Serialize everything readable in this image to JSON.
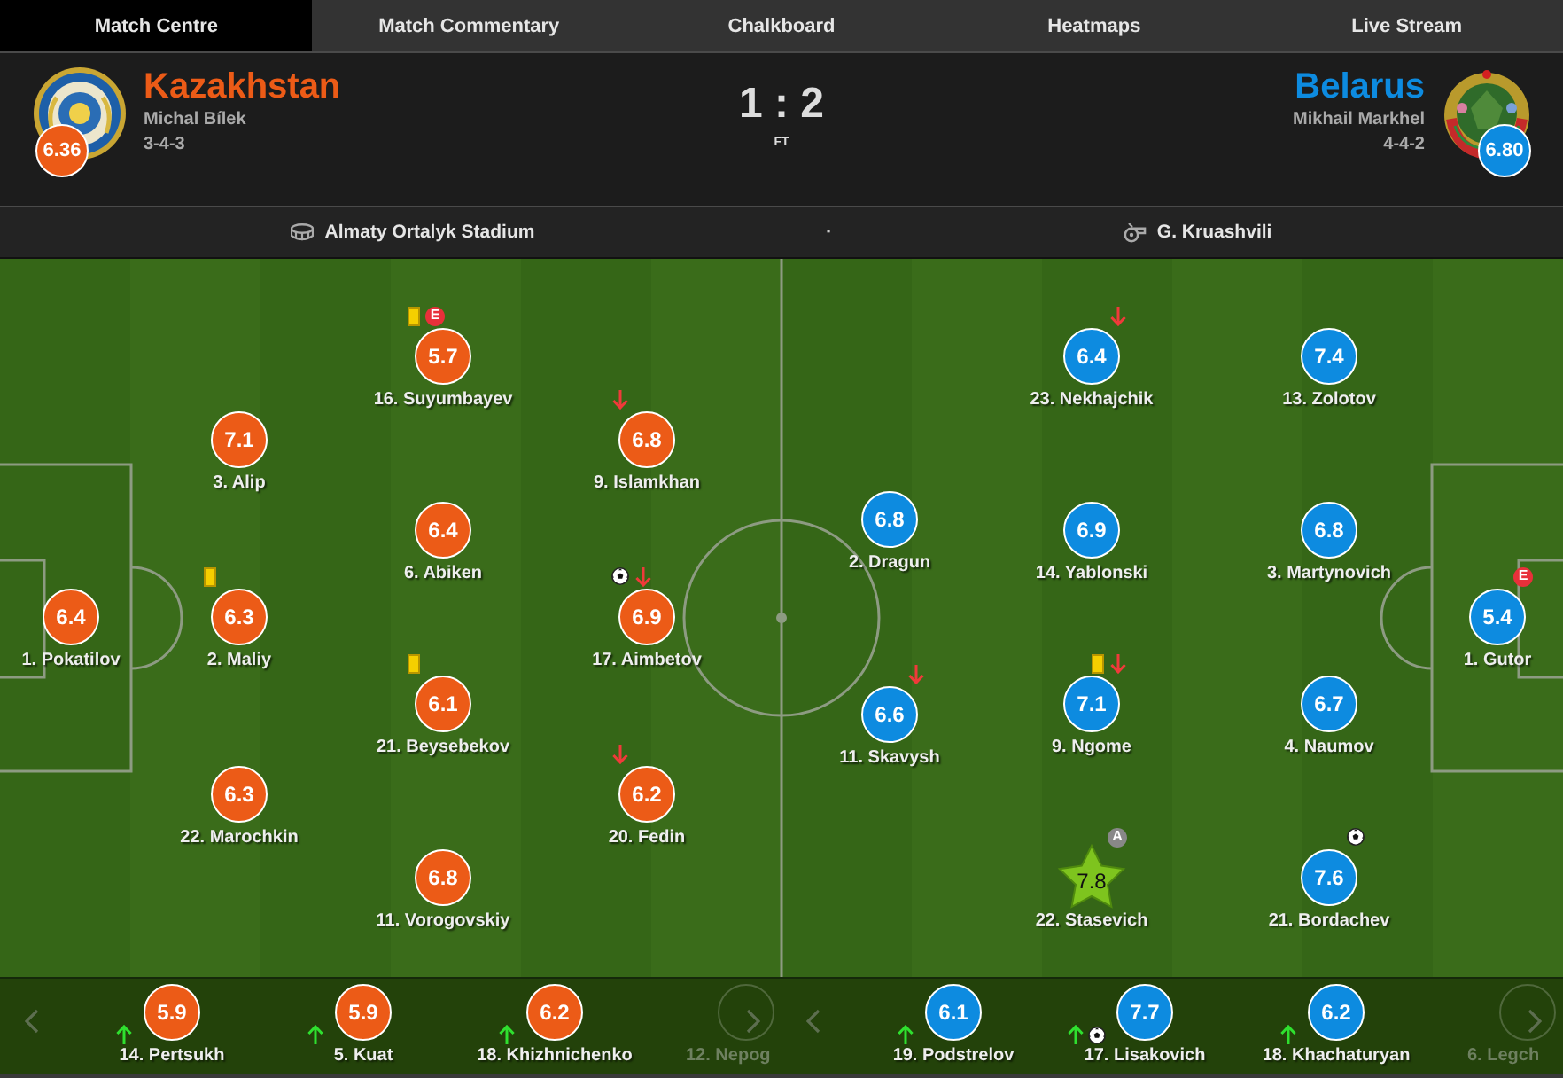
{
  "tabs": [
    {
      "label": "Match Centre",
      "selected": true
    },
    {
      "label": "Match Commentary",
      "selected": false
    },
    {
      "label": "Chalkboard",
      "selected": false
    },
    {
      "label": "Heatmaps",
      "selected": false
    },
    {
      "label": "Live Stream",
      "selected": false
    }
  ],
  "teams": [
    {
      "name": "Kazakhstan",
      "manager": "Michal Bílek",
      "formation": "3-4-3",
      "rating": "6.36",
      "color": "#ec5b17",
      "lines": [
        [
          {
            "name": "1. Pokatilov",
            "rating": "6.4",
            "top_rated": false
          }
        ],
        [
          {
            "name": "3. Alip",
            "rating": "7.1",
            "top_rated": false
          },
          {
            "name": "2. Maliy",
            "rating": "6.3",
            "top_rated": false,
            "events": [
              {
                "kind": "yellow_card"
              }
            ]
          },
          {
            "name": "22. Marochkin",
            "rating": "6.3",
            "top_rated": false
          }
        ],
        [
          {
            "name": "16. Suyumbayev",
            "rating": "5.7",
            "top_rated": false,
            "events": [
              {
                "kind": "yellow_card"
              },
              {
                "kind": "error",
                "label": "E"
              }
            ]
          },
          {
            "name": "6. Abiken",
            "rating": "6.4",
            "top_rated": false
          },
          {
            "name": "21. Beysebekov",
            "rating": "6.1",
            "top_rated": false,
            "events": [
              {
                "kind": "yellow_card"
              }
            ]
          },
          {
            "name": "11. Vorogovskiy",
            "rating": "6.8",
            "top_rated": false
          }
        ],
        [
          {
            "name": "9. Islamkhan",
            "rating": "6.8",
            "top_rated": false,
            "events": [
              {
                "kind": "sub_off"
              }
            ]
          },
          {
            "name": "17. Aimbetov",
            "rating": "6.9",
            "top_rated": false,
            "events": [
              {
                "kind": "goal"
              },
              {
                "kind": "sub_off"
              }
            ]
          },
          {
            "name": "20. Fedin",
            "rating": "6.2",
            "top_rated": false,
            "events": [
              {
                "kind": "sub_off"
              }
            ]
          }
        ]
      ],
      "bench": [
        {
          "name": "14. Pertsukh",
          "rating": "5.9",
          "faded": false,
          "events": [
            {
              "kind": "sub_on"
            }
          ]
        },
        {
          "name": "5. Kuat",
          "rating": "5.9",
          "faded": false,
          "events": [
            {
              "kind": "sub_on"
            }
          ]
        },
        {
          "name": "18. Khizhnichenko",
          "rating": "6.2",
          "faded": false,
          "events": [
            {
              "kind": "sub_on"
            }
          ]
        },
        {
          "name": "12. Nepog",
          "faded": true
        }
      ]
    },
    {
      "name": "Belarus",
      "manager": "Mikhail Markhel",
      "formation": "4-4-2",
      "rating": "6.80",
      "color": "#0d8be0",
      "lines": [
        [
          {
            "name": "2. Dragun",
            "rating": "6.8",
            "top_rated": false
          },
          {
            "name": "11. Skavysh",
            "rating": "6.6",
            "top_rated": false,
            "events": [
              {
                "kind": "sub_off"
              }
            ]
          }
        ],
        [
          {
            "name": "23. Nekhajchik",
            "rating": "6.4",
            "top_rated": false,
            "events": [
              {
                "kind": "sub_off"
              }
            ]
          },
          {
            "name": "14. Yablonski",
            "rating": "6.9",
            "top_rated": false
          },
          {
            "name": "9. Ngome",
            "rating": "7.1",
            "top_rated": false,
            "events": [
              {
                "kind": "yellow_card"
              },
              {
                "kind": "sub_off"
              }
            ]
          },
          {
            "name": "22. Stasevich",
            "rating": "7.8",
            "top_rated": true,
            "events": [
              {
                "kind": "assist",
                "label": "A"
              }
            ]
          }
        ],
        [
          {
            "name": "13. Zolotov",
            "rating": "7.4",
            "top_rated": false
          },
          {
            "name": "3. Martynovich",
            "rating": "6.8",
            "top_rated": false
          },
          {
            "name": "4. Naumov",
            "rating": "6.7",
            "top_rated": false
          },
          {
            "name": "21. Bordachev",
            "rating": "7.6",
            "top_rated": false,
            "events": [
              {
                "kind": "goal"
              }
            ]
          }
        ],
        [
          {
            "name": "1. Gutor",
            "rating": "5.4",
            "top_rated": false,
            "events": [
              {
                "kind": "error",
                "label": "E"
              }
            ]
          }
        ]
      ],
      "bench": [
        {
          "name": "19. Podstrelov",
          "rating": "6.1",
          "faded": false,
          "events": [
            {
              "kind": "sub_on"
            }
          ]
        },
        {
          "name": "17. Lisakovich",
          "rating": "7.7",
          "faded": false,
          "events": [
            {
              "kind": "sub_on"
            },
            {
              "kind": "goal"
            }
          ]
        },
        {
          "name": "18. Khachaturyan",
          "rating": "6.2",
          "faded": false,
          "events": [
            {
              "kind": "sub_on"
            }
          ]
        },
        {
          "name": "6. Legch",
          "faded": true
        }
      ]
    }
  ],
  "score": {
    "result": "1 : 2",
    "status": "FT"
  },
  "info_bar": {
    "venue": "Almaty Ortalyk Stadium",
    "separator": "·",
    "referee": "G. Kruashvili"
  }
}
